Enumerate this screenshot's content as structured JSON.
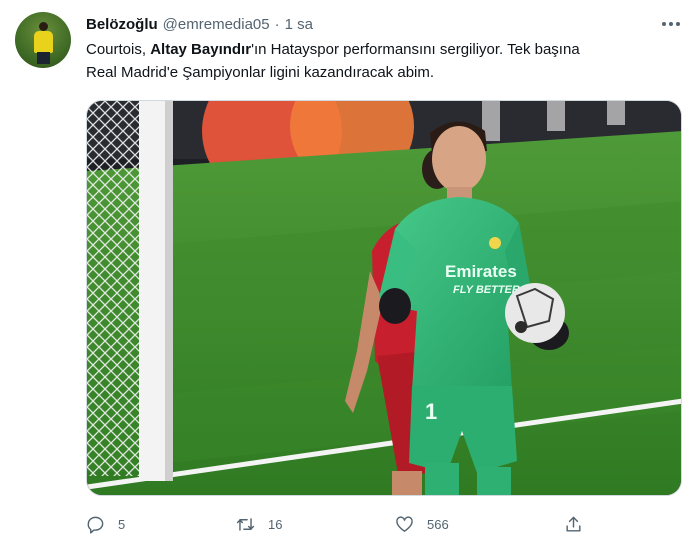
{
  "tweet": {
    "display_name": "Belözoğlu",
    "handle": "@emremedia05",
    "separator": "·",
    "time": "1 sa",
    "text_parts": {
      "before": "Courtois, ",
      "bold": "Altay Bayındır",
      "after_line1": "'ın Hatayspor performansını sergiliyor. Tek başına",
      "line2": "Real Madrid'e Şampiyonlar ligini kazandıracak abim."
    },
    "media": {
      "jersey_sponsor_line1": "Emirates",
      "jersey_sponsor_line2": "FLY BETTER",
      "shirt_number": "1"
    },
    "counts": {
      "replies": "5",
      "retweets": "16",
      "likes": "566"
    }
  },
  "icons": {
    "reply": "reply-icon",
    "retweet": "retweet-icon",
    "like": "heart-icon",
    "share": "share-icon",
    "more": "more-icon"
  },
  "colors": {
    "text": "#0f1419",
    "secondary": "#536471",
    "pitch": "#3f8a2c",
    "kit": "#34b779"
  }
}
